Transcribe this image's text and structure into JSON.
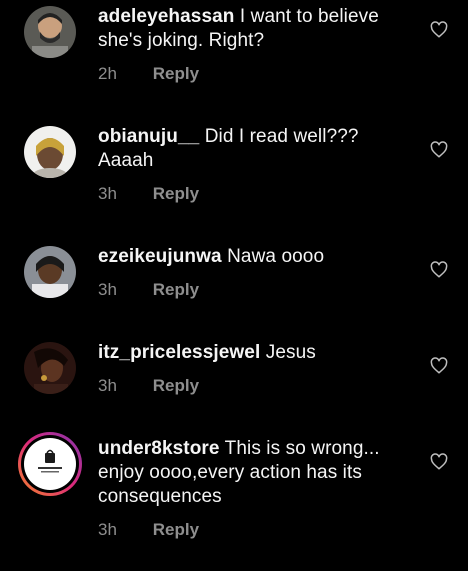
{
  "comments": [
    {
      "username": "adeleyehassan",
      "text": "I want to believe she's joking. Right?",
      "time": "2h",
      "reply_label": "Reply"
    },
    {
      "username": "obianuju__",
      "text": "Did I read well??? Aaaah",
      "time": "3h",
      "reply_label": "Reply"
    },
    {
      "username": "ezeikeujunwa",
      "text": "Nawa oooo",
      "time": "3h",
      "reply_label": "Reply"
    },
    {
      "username": "itz_pricelessjewel",
      "text": "Jesus",
      "time": "3h",
      "reply_label": "Reply"
    },
    {
      "username": "under8kstore",
      "text": "This is so wrong... enjoy oooo,every action has its consequences",
      "time": "3h",
      "reply_label": "Reply"
    }
  ],
  "icons": {
    "like": "heart-outline-icon"
  },
  "colors": {
    "background": "#000000",
    "text": "#f5f5f5",
    "muted": "#8e8e8e",
    "story_ring_start": "#f58529",
    "story_ring_end": "#dd2a7b"
  }
}
